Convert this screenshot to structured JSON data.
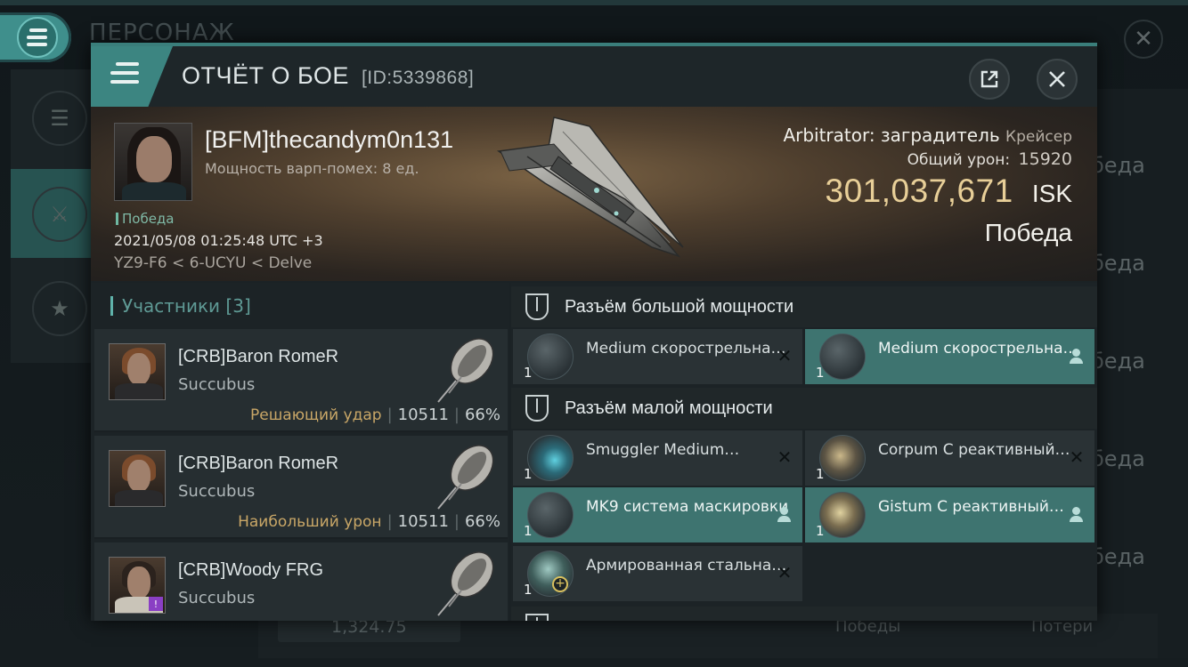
{
  "background": {
    "title": "ПЕРСОНАЖ",
    "right_list": [
      "беда",
      "беда",
      "беда",
      "беда",
      "беда"
    ],
    "bottom_value": "1,324.75",
    "bottom_labels": [
      "Победы",
      "Потери"
    ]
  },
  "header": {
    "title": "ОТЧЁТ О БОЕ",
    "report_id": "[ID:5339868]"
  },
  "victim": {
    "name": "[BFM]thecandym0n131",
    "warp_disruption": "Мощность варп-помех: 8 ед.",
    "status_tag": "Победа",
    "datetime": "2021/05/08 01:25:48 UTC +3",
    "location": "YZ9-F6 < 6-UCYU < Delve",
    "ship": "Arbitrator: заградитель",
    "ship_class": "Крейсер",
    "total_damage_label": "Общий урон:",
    "total_damage": "15920",
    "isk_value": "301,037,671",
    "isk_currency": "ISK",
    "result": "Победа"
  },
  "participants": {
    "header": "Участники [3]",
    "rows": [
      {
        "name": "[CRB]Baron RomeR",
        "ship": "Succubus",
        "role": "Решающий удар",
        "damage": "10511",
        "percent": "66%"
      },
      {
        "name": "[CRB]Baron RomeR",
        "ship": "Succubus",
        "role": "Наибольший урон",
        "damage": "10511",
        "percent": "66%"
      },
      {
        "name": "[CRB]Woody FRG",
        "ship": "Succubus",
        "role": "",
        "damage": "",
        "percent": ""
      }
    ]
  },
  "slots": {
    "high": {
      "title": "Разъём большой мощности",
      "modules": [
        {
          "name": "Medium скорострельная…",
          "qty": "1",
          "state": "destroyed"
        },
        {
          "name": "Medium скорострельная…",
          "qty": "1",
          "state": "dropped"
        }
      ]
    },
    "low": {
      "title": "Разъём малой мощности",
      "modules": [
        {
          "name": "Smuggler Medium…",
          "qty": "1",
          "state": "destroyed"
        },
        {
          "name": "Corpum C реактивный…",
          "qty": "1",
          "state": "destroyed"
        },
        {
          "name": "MK9 система маскировки",
          "qty": "1",
          "state": "dropped"
        },
        {
          "name": "Gistum C реактивный…",
          "qty": "1",
          "state": "dropped"
        },
        {
          "name": "Армированная стальная…",
          "qty": "1",
          "state": "destroyed"
        }
      ]
    }
  },
  "colors": {
    "accent": "#3c8581",
    "isk": "#e8cf98",
    "role": "#c9a767"
  }
}
